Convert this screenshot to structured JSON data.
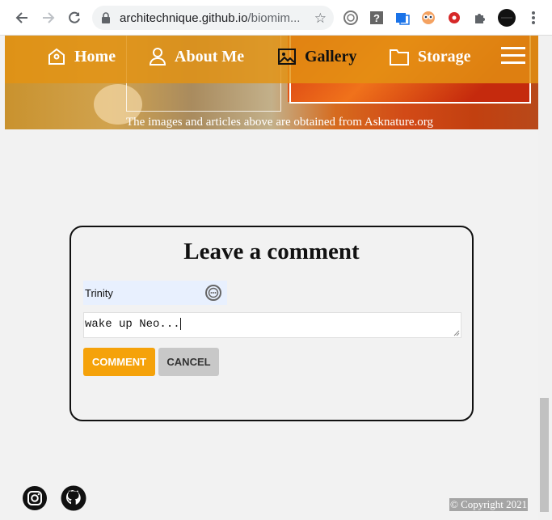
{
  "browser": {
    "url_host": "architechnique.github.io",
    "url_path": "/biomim..."
  },
  "nav": {
    "items": [
      {
        "label": "Home",
        "icon": "birdhouse-icon"
      },
      {
        "label": "About Me",
        "icon": "person-icon"
      },
      {
        "label": "Gallery",
        "icon": "image-icon"
      },
      {
        "label": "Storage",
        "icon": "folder-icon"
      }
    ]
  },
  "hero": {
    "credit": "The images and articles above are obtained from Asknature.org"
  },
  "comment_form": {
    "title": "Leave a comment",
    "name_value": "Trinity",
    "comment_value": "wake up Neo...",
    "comment_label": "COMMENT",
    "cancel_label": "CANCEL"
  },
  "footer": {
    "copyright": "© Copyright 2021"
  },
  "colors": {
    "nav_bg": "#e39212",
    "accent": "#f5a20a",
    "cancel": "#c8c8c8"
  }
}
